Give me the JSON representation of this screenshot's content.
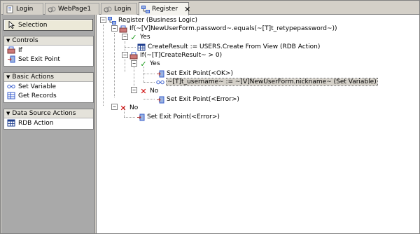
{
  "tabs": [
    {
      "label": "Login",
      "icon": "page-icon"
    },
    {
      "label": "WebPage1",
      "icon": "link-icon"
    },
    {
      "label": "Login",
      "icon": "link-icon"
    },
    {
      "label": "Register",
      "icon": "flow-icon",
      "active": true
    }
  ],
  "palette": {
    "selection_label": "Selection",
    "groups": [
      {
        "title": "Controls",
        "items": [
          {
            "label": "If",
            "icon": "if-icon"
          },
          {
            "label": "Set Exit Point",
            "icon": "exit-point-icon"
          }
        ]
      },
      {
        "title": "Basic Actions",
        "items": [
          {
            "label": "Set Variable",
            "icon": "variable-icon"
          },
          {
            "label": "Get Records",
            "icon": "records-icon"
          }
        ]
      },
      {
        "title": "Data Source Actions",
        "items": [
          {
            "label": "RDB Action",
            "icon": "table-icon"
          }
        ]
      }
    ]
  },
  "tree": {
    "root": "Register (Business Logic)",
    "if1": "If(~[V]NewUserForm.password~.equals(~[T]t_retypepassword~))",
    "yes1": "Yes",
    "create_result": "CreateResult := USERS.Create From View (RDB Action)",
    "if2": "If(~[T]CreateResult~ > 0)",
    "yes2": "Yes",
    "exit_ok": "Set Exit Point(<OK>)",
    "set_var": "~[T]t_username~ := ~[V]NewUserForm.nickname~ (Set Variable)",
    "no2": "No",
    "exit_error2": "Set Exit Point(<Error>)",
    "no1": "No",
    "exit_error1": "Set Exit Point(<Error>)"
  },
  "colors": {
    "yes": "#1a9a1a",
    "no": "#cc0000",
    "accent": "#3a5fcd"
  }
}
